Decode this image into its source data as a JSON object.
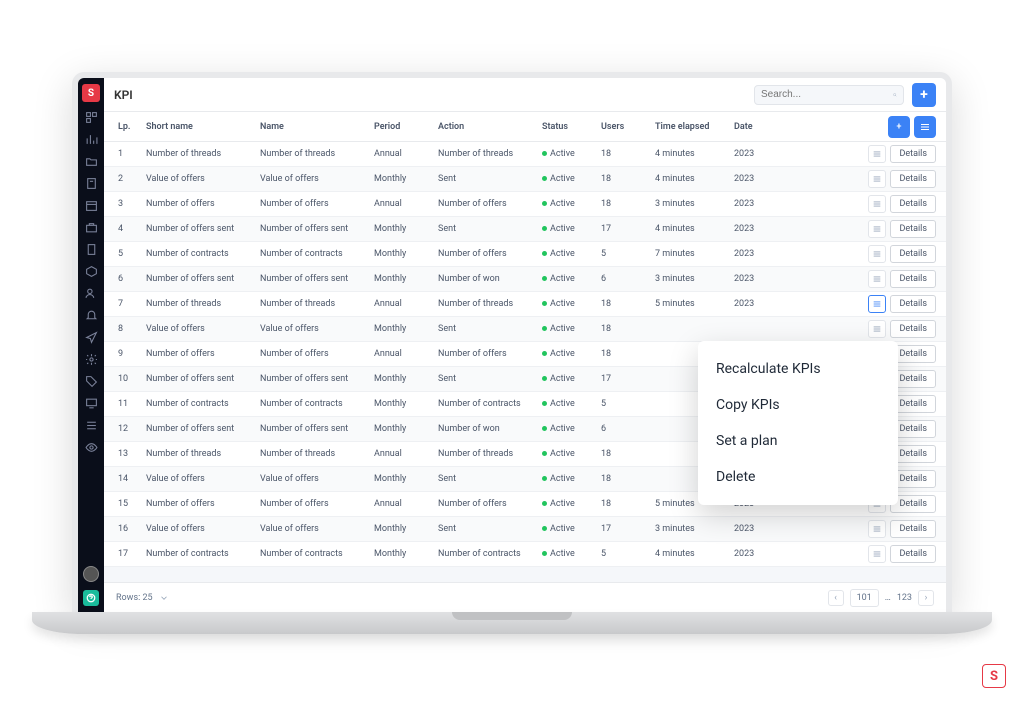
{
  "page_title": "KPI",
  "search": {
    "placeholder": "Search..."
  },
  "columns": {
    "lp": "Lp.",
    "short": "Short name",
    "name": "Name",
    "period": "Period",
    "action": "Action",
    "status": "Status",
    "users": "Users",
    "time": "Time elapsed",
    "date": "Date"
  },
  "status_label": "Active",
  "details_label": "Details",
  "rows": [
    {
      "lp": "1",
      "short": "Number of threads",
      "name": "Number of threads",
      "period": "Annual",
      "action": "Number of threads",
      "users": "18",
      "time": "4 minutes",
      "date": "2023"
    },
    {
      "lp": "2",
      "short": "Value of offers",
      "name": "Value of offers",
      "period": "Monthly",
      "action": "Sent",
      "users": "18",
      "time": "4 minutes",
      "date": "2023"
    },
    {
      "lp": "3",
      "short": "Number of offers",
      "name": "Number of offers",
      "period": "Annual",
      "action": "Number of offers",
      "users": "18",
      "time": "3 minutes",
      "date": "2023"
    },
    {
      "lp": "4",
      "short": "Number of offers sent",
      "name": "Number of offers sent",
      "period": "Monthly",
      "action": "Sent",
      "users": "17",
      "time": "4 minutes",
      "date": "2023"
    },
    {
      "lp": "5",
      "short": "Number of contracts",
      "name": "Number of contracts",
      "period": "Monthly",
      "action": "Number of offers",
      "users": "5",
      "time": "7 minutes",
      "date": "2023"
    },
    {
      "lp": "6",
      "short": "Number of offers sent",
      "name": "Number of offers sent",
      "period": "Monthly",
      "action": "Number of won",
      "users": "6",
      "time": "3 minutes",
      "date": "2023"
    },
    {
      "lp": "7",
      "short": "Number of threads",
      "name": "Number of threads",
      "period": "Annual",
      "action": "Number of threads",
      "users": "18",
      "time": "5 minutes",
      "date": "2023"
    },
    {
      "lp": "8",
      "short": "Value of offers",
      "name": "Value of offers",
      "period": "Monthly",
      "action": "Sent",
      "users": "18",
      "time": "",
      "date": ""
    },
    {
      "lp": "9",
      "short": "Number of offers",
      "name": "Number of offers",
      "period": "Annual",
      "action": "Number of offers",
      "users": "18",
      "time": "",
      "date": ""
    },
    {
      "lp": "10",
      "short": "Number of offers sent",
      "name": "Number of offers sent",
      "period": "Monthly",
      "action": "Sent",
      "users": "17",
      "time": "",
      "date": ""
    },
    {
      "lp": "11",
      "short": "Number of contracts",
      "name": "Number of contracts",
      "period": "Monthly",
      "action": "Number of contracts",
      "users": "5",
      "time": "",
      "date": ""
    },
    {
      "lp": "12",
      "short": "Number of offers sent",
      "name": "Number of offers sent",
      "period": "Monthly",
      "action": "Number of won",
      "users": "6",
      "time": "",
      "date": ""
    },
    {
      "lp": "13",
      "short": "Number of threads",
      "name": "Number of threads",
      "period": "Annual",
      "action": "Number of threads",
      "users": "18",
      "time": "",
      "date": ""
    },
    {
      "lp": "14",
      "short": "Value of offers",
      "name": "Value of offers",
      "period": "Monthly",
      "action": "Sent",
      "users": "18",
      "time": "",
      "date": ""
    },
    {
      "lp": "15",
      "short": "Number of offers",
      "name": "Number of offers",
      "period": "Annual",
      "action": "Number of offers",
      "users": "18",
      "time": "5 minutes",
      "date": "2023"
    },
    {
      "lp": "16",
      "short": "Value of offers",
      "name": "Value of offers",
      "period": "Monthly",
      "action": "Sent",
      "users": "17",
      "time": "3 minutes",
      "date": "2023"
    },
    {
      "lp": "17",
      "short": "Number of contracts",
      "name": "Number of contracts",
      "period": "Monthly",
      "action": "Number of contracts",
      "users": "5",
      "time": "4 minutes",
      "date": "2023"
    }
  ],
  "dropdown": {
    "recalculate": "Recalculate KPIs",
    "copy": "Copy KPIs",
    "plan": "Set a plan",
    "delete": "Delete"
  },
  "footer": {
    "rows_label": "Rows: 25",
    "page_current": "101",
    "ellipsis": "…",
    "page_last": "123"
  },
  "brand": "S"
}
